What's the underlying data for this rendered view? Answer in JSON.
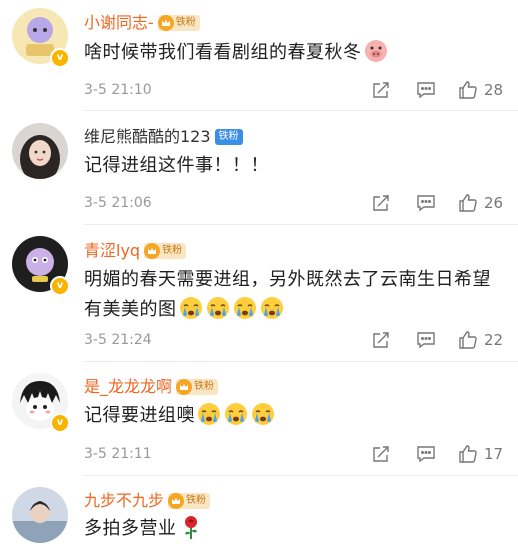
{
  "comments": [
    {
      "name": "小谢同志-",
      "badge": "铁粉",
      "badge_style": "gold",
      "text": "啥时候带我们看看剧组的春夏秋冬",
      "time": "3-5 21:10",
      "likes": "28"
    },
    {
      "name": "维尼熊酷酷的123",
      "badge": "铁粉",
      "badge_style": "blue",
      "text": "记得进组这件事！！！",
      "time": "3-5 21:06",
      "likes": "26"
    },
    {
      "name": "青涩lyq",
      "badge": "铁粉",
      "badge_style": "gold",
      "text": "明媚的春天需要进组，另外既然去了云南生日希望有美美的图",
      "time": "3-5 21:24",
      "likes": "22"
    },
    {
      "name": "是_龙龙龙啊",
      "badge": "铁粉",
      "badge_style": "gold",
      "text": "记得要进组噢",
      "time": "3-5 21:11",
      "likes": "17"
    },
    {
      "name": "九步不九步",
      "badge": "铁粉",
      "badge_style": "gold",
      "text": "多拍多营业",
      "time": "",
      "likes": ""
    }
  ],
  "icons": {
    "share": "share-icon",
    "comment": "comment-icon",
    "like": "like-icon",
    "crying_emoji": "crying-emoji-icon",
    "rose": "rose-icon",
    "pig": "pig-emoji-icon"
  },
  "colors": {
    "name_orange": "#f0661f",
    "time_gray": "#999999",
    "badge_gold": "#f5a623",
    "badge_blue": "#3a8ee6"
  }
}
